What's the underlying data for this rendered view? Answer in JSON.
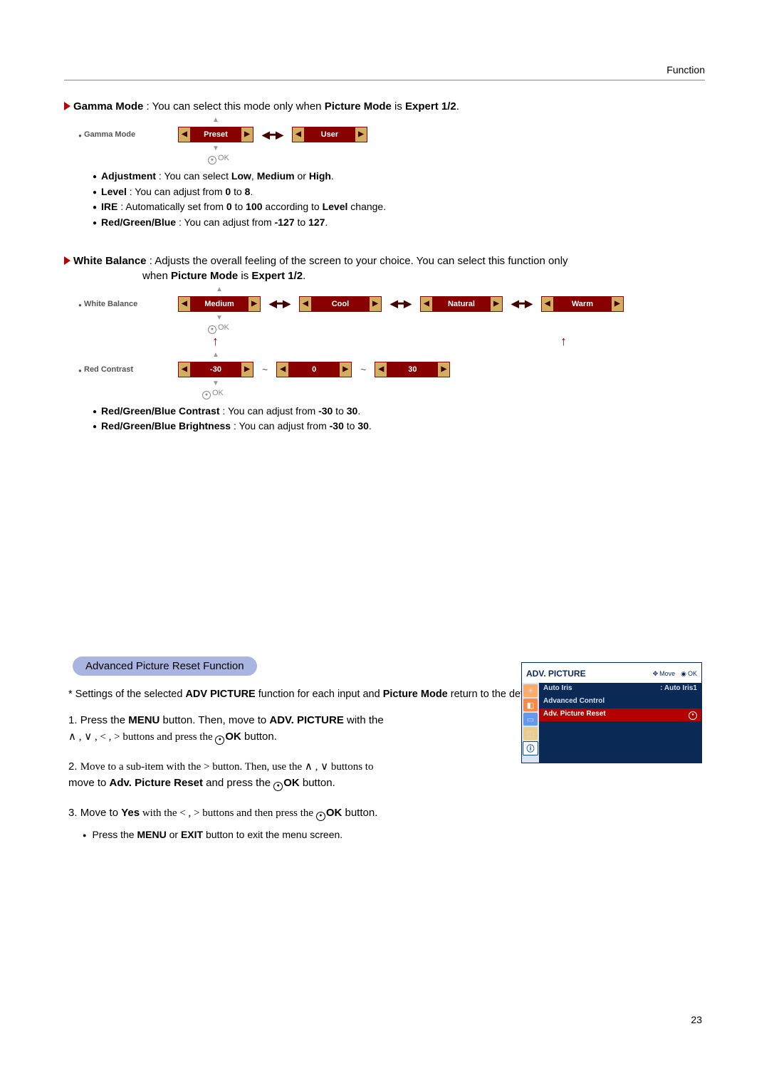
{
  "header": "Function",
  "gamma": {
    "title": "Gamma Mode",
    "desc_pre": " : You can select this mode only when ",
    "desc_b1": "Picture Mode",
    "desc_mid": " is ",
    "desc_b2": "Expert 1/2",
    "label": "Gamma Mode",
    "preset": "Preset",
    "user": "User",
    "ok": "OK",
    "b1_label": "Adjustment",
    "b1_text": " : You can select ",
    "b1_v1": "Low",
    "b1_sep1": ", ",
    "b1_v2": "Medium",
    "b1_sep2": " or ",
    "b1_v3": "High",
    "b2_label": "Level",
    "b2_text": " : You can adjust from ",
    "b2_v1": "0",
    "b2_mid": " to ",
    "b2_v2": "8",
    "b3_label": "IRE",
    "b3_text": " : Automatically set from ",
    "b3_v1": "0",
    "b3_mid": " to ",
    "b3_v2": "100",
    "b3_tail": " according to ",
    "b3_b": "Level",
    "b3_end": " change.",
    "b4_label": "Red/Green/Blue",
    "b4_text": "  : You can adjust from ",
    "b4_v1": "-127",
    "b4_mid": " to ",
    "b4_v2": "127"
  },
  "wb": {
    "title": "White Balance",
    "desc_pre": " : Adjusts the overall feeling of the screen to your choice. You can select this function only",
    "desc_line2_pre": "when ",
    "desc_b1": "Picture Mode",
    "desc_mid": " is ",
    "desc_b2": "Expert 1/2",
    "label": "White Balance",
    "medium": "Medium",
    "cool": "Cool",
    "natural": "Natural",
    "warm": "Warm",
    "ok": "OK",
    "rc_label": "Red Contrast",
    "rc_v1": "-30",
    "rc_v2": "0",
    "rc_v3": "30",
    "b1_label": "Red/Green/Blue Contrast",
    "b1_text": " : You can adjust from ",
    "b1_v1": "-30",
    "b1_mid": " to ",
    "b1_v2": "30",
    "b2_label": "Red/Green/Blue Brightness",
    "b2_text": " : You can adjust from ",
    "b2_v1": "-30",
    "b2_mid": " to ",
    "b2_v2": "30"
  },
  "reset": {
    "pill": "Advanced Picture Reset Function",
    "desc_star": "* Settings of the selected ",
    "desc_b1": "ADV PICTURE",
    "desc_mid": " function for each input and ",
    "desc_b2": "Picture Mode",
    "desc_end": " return to the default factory settings.",
    "s1a": "Press the ",
    "s1b": "MENU",
    "s1c": " button. Then, move to ",
    "s1d": "ADV. PICTURE",
    "s1e": " with the",
    "s1f_pre": "∧ , ∨ , < , >  buttons and press the ",
    "s1f_ok": "OK",
    "s1f_end": " button.",
    "s2a": "Move to a sub-item with the  >  button. Then, use the  ∧ , ∨  buttons to",
    "s2b": "move to ",
    "s2c": "Adv. Picture Reset",
    "s2d": " and press the ",
    "s2ok": "OK",
    "s2e": " button.",
    "s3a": "Move to ",
    "s3b": "Yes",
    "s3c": " with the  < , >  buttons and then press the ",
    "s3ok": "OK",
    "s3d": " button.",
    "sub": "Press the ",
    "sub_b1": "MENU",
    "sub_mid": " or ",
    "sub_b2": "EXIT",
    "sub_end": " button to exit the menu screen."
  },
  "osd": {
    "title": "ADV. PICTURE",
    "move": "Move",
    "ok": "OK",
    "r1a": "Auto Iris",
    "r1b": ": Auto Iris1",
    "r2": "Advanced Control",
    "r3": "Adv. Picture Reset"
  },
  "page": "23"
}
